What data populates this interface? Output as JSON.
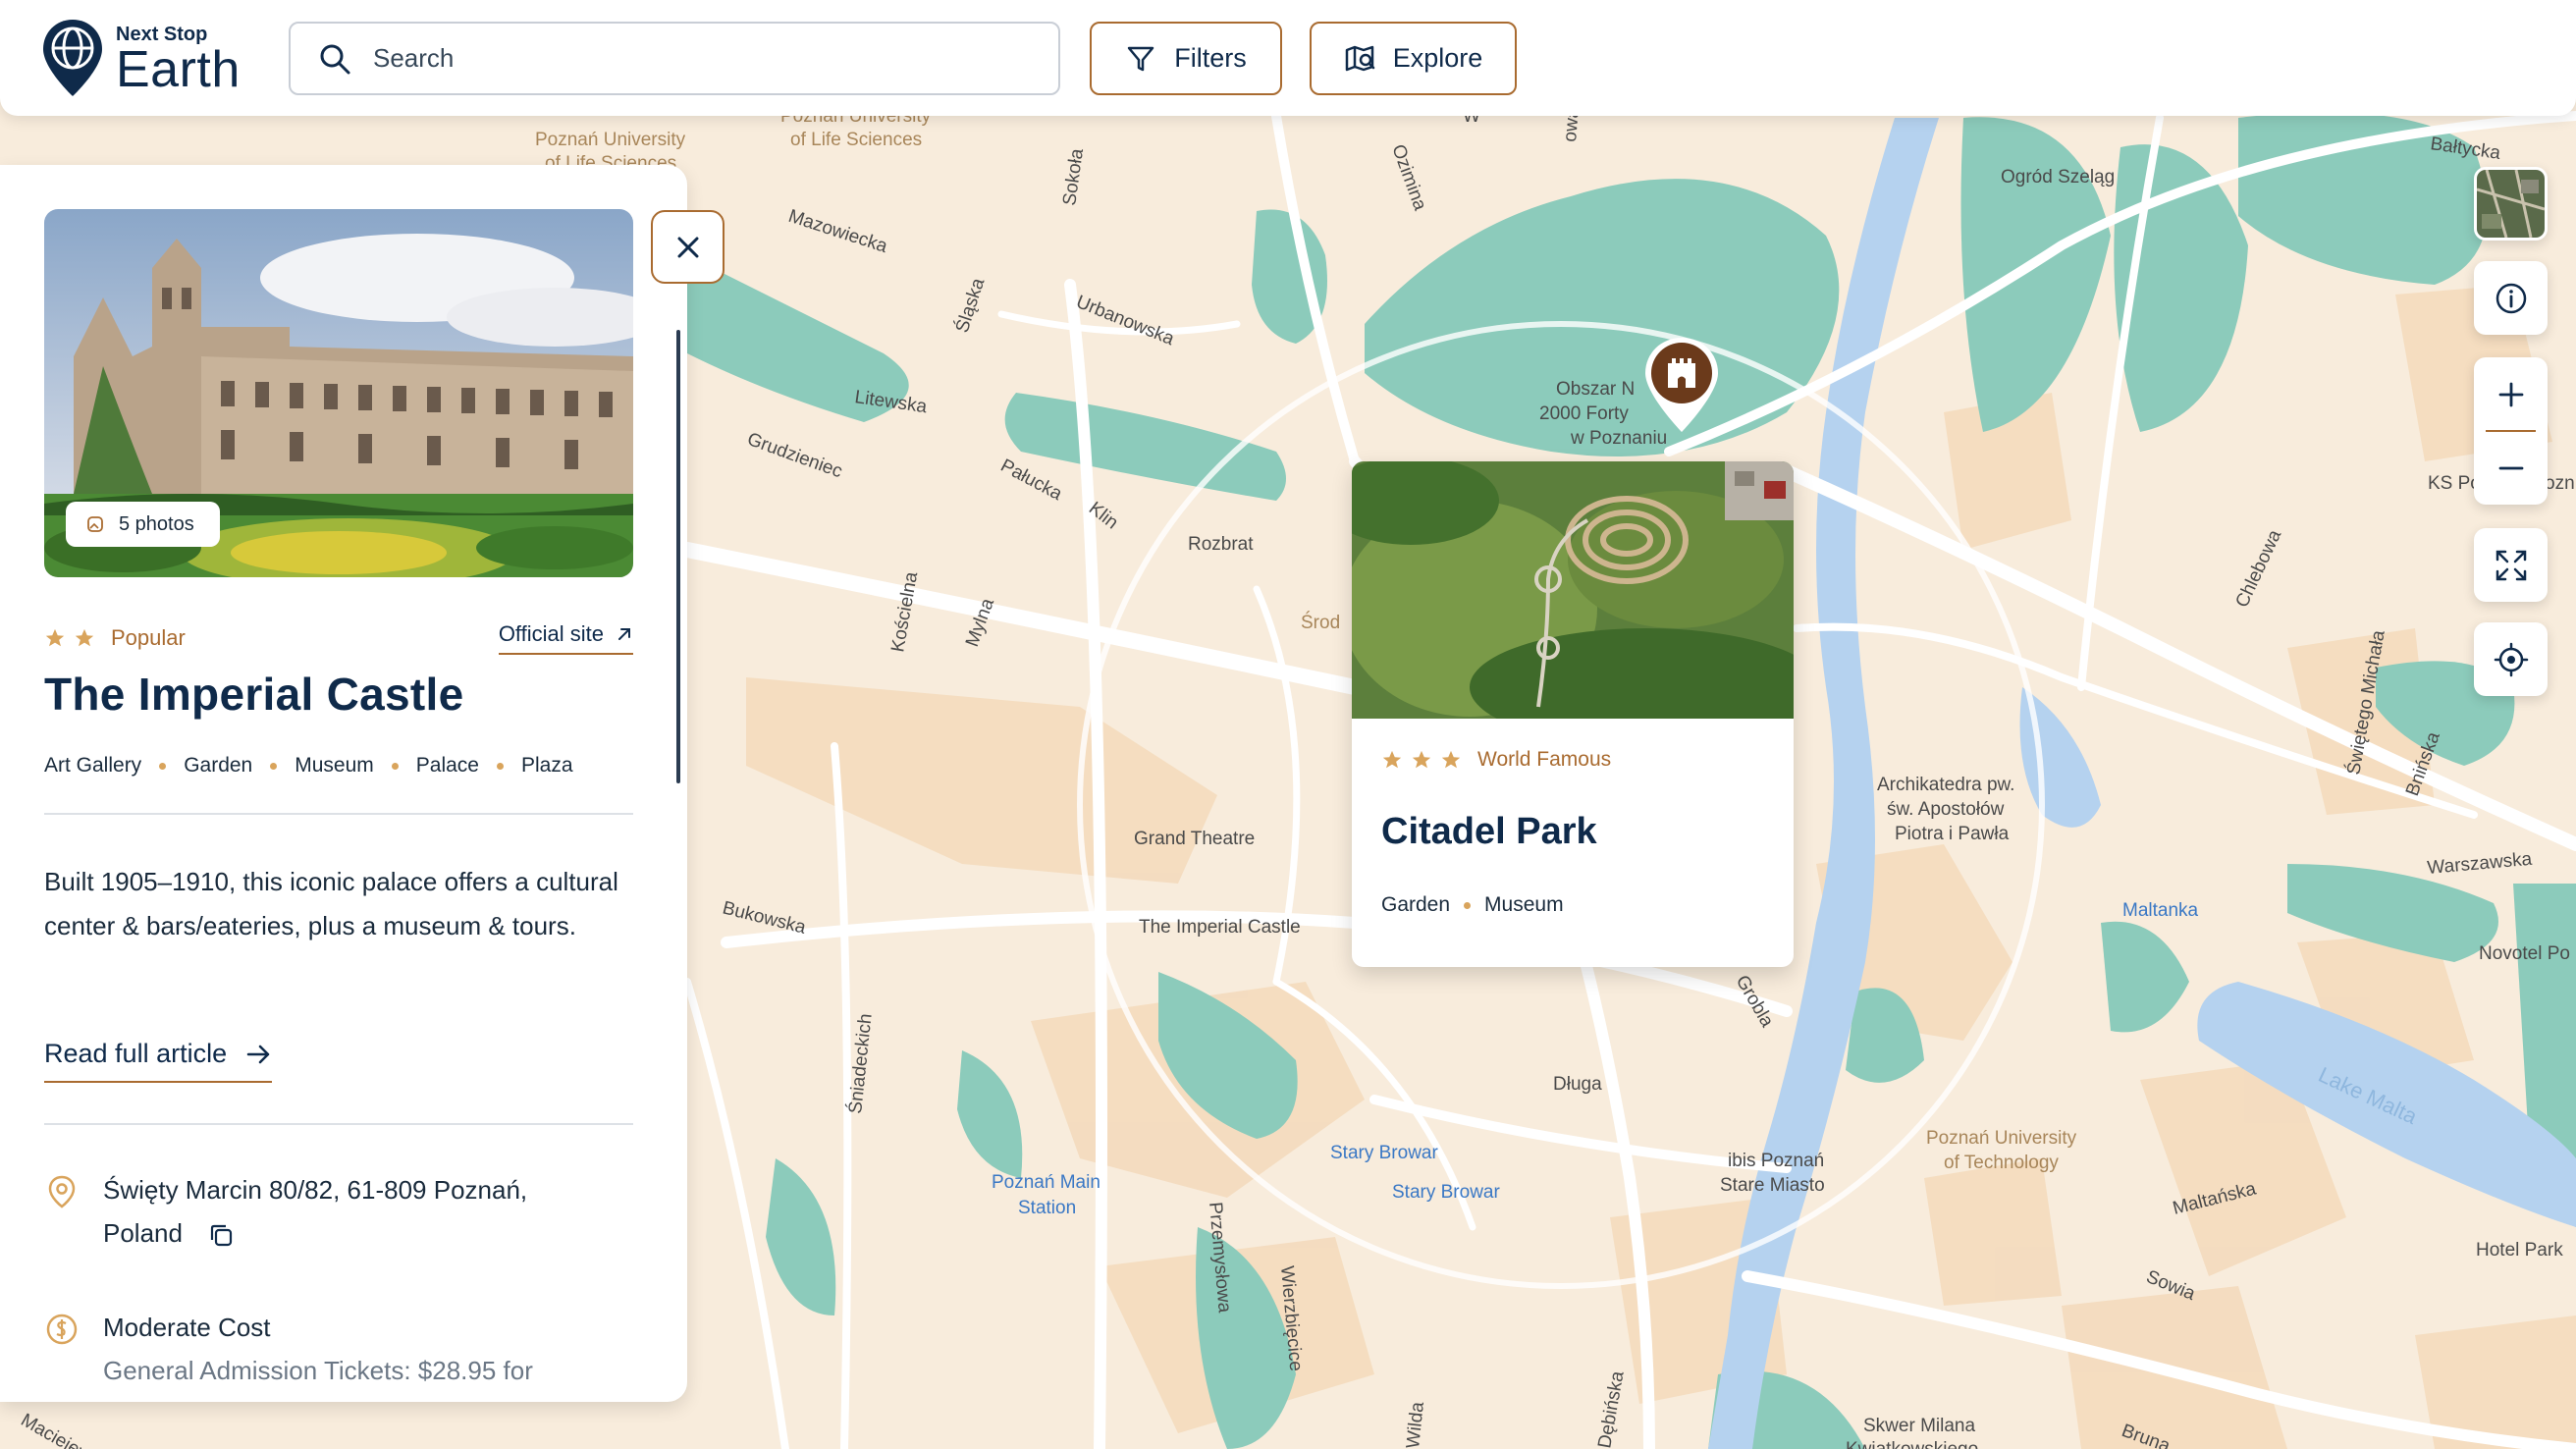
{
  "header": {
    "logo_small": "Next Stop",
    "logo_big": "Earth",
    "search_placeholder": "Search",
    "filters_label": "Filters",
    "explore_label": "Explore"
  },
  "panel": {
    "photos_label": "5 photos",
    "rating_label": "Popular",
    "rating_stars": 2,
    "official_site_label": "Official site",
    "title": "The Imperial Castle",
    "tags": [
      "Art Gallery",
      "Garden",
      "Museum",
      "Palace",
      "Plaza"
    ],
    "description": "Built 1905–1910, this iconic palace offers a cultural center & bars/eateries, plus a museum & tours.",
    "read_more_label": "Read full article",
    "address_line1": "Święty Marcin 80/82, 61-809 Poznań,",
    "address_line2": "Poland",
    "cost_label": "Moderate Cost",
    "cost_detail": "General Admission Tickets: $28.95 for"
  },
  "popup": {
    "rating_label": "World Famous",
    "rating_stars": 3,
    "title": "Citadel Park",
    "tags": [
      "Garden",
      "Museum"
    ]
  },
  "map": {
    "labels": [
      {
        "text": "Poznań University",
        "kind": "brown"
      },
      {
        "text": "of Life Sciences",
        "kind": "brown"
      },
      {
        "text": "Poznań University",
        "kind": "brown"
      },
      {
        "text": "of Life Sciences",
        "kind": "brown"
      },
      {
        "text": "Mazowiecka",
        "kind": "street"
      },
      {
        "text": "Sokoła",
        "kind": "street"
      },
      {
        "text": "Śląska",
        "kind": "street"
      },
      {
        "text": "Urbanowska",
        "kind": "street"
      },
      {
        "text": "Litewska",
        "kind": "street"
      },
      {
        "text": "Grudzieniec",
        "kind": "street"
      },
      {
        "text": "Pałucka",
        "kind": "street"
      },
      {
        "text": "Klin",
        "kind": "street"
      },
      {
        "text": "Rozbrat",
        "kind": "street"
      },
      {
        "text": "Kościelna",
        "kind": "street"
      },
      {
        "text": "Mylna",
        "kind": "street"
      },
      {
        "text": "Grand Theatre",
        "kind": "street"
      },
      {
        "text": "The Imperial Castle",
        "kind": "street"
      },
      {
        "text": "Bukowska",
        "kind": "street"
      },
      {
        "text": "Śniadeckich",
        "kind": "street"
      },
      {
        "text": "Poznań Main",
        "kind": "blue"
      },
      {
        "text": "Station",
        "kind": "blue"
      },
      {
        "text": "Przemysłowa",
        "kind": "street"
      },
      {
        "text": "Wierzbięcice",
        "kind": "street"
      },
      {
        "text": "Stary Browar",
        "kind": "blue"
      },
      {
        "text": "Stary Browar",
        "kind": "blue"
      },
      {
        "text": "Długa",
        "kind": "street"
      },
      {
        "text": "Grobla",
        "kind": "street"
      },
      {
        "text": "ibis Poznań",
        "kind": "street"
      },
      {
        "text": "Stare Miasto",
        "kind": "street"
      },
      {
        "text": "Poznań University",
        "kind": "brown"
      },
      {
        "text": "of Technology",
        "kind": "brown"
      },
      {
        "text": "Archikatedra pw.",
        "kind": "street"
      },
      {
        "text": "św. Apostołów",
        "kind": "street"
      },
      {
        "text": "Piotra i Pawła",
        "kind": "street"
      },
      {
        "text": "Maltanka",
        "kind": "blue"
      },
      {
        "text": "Warszawska",
        "kind": "street"
      },
      {
        "text": "Novotel Po",
        "kind": "street"
      },
      {
        "text": "Lake Malta",
        "kind": "street"
      },
      {
        "text": "Maltańska",
        "kind": "street"
      },
      {
        "text": "Hotel Park",
        "kind": "street"
      },
      {
        "text": "Sowia",
        "kind": "street"
      },
      {
        "text": "Ogród Szeląg",
        "kind": "street"
      },
      {
        "text": "Bałtycka",
        "kind": "street"
      },
      {
        "text": "KS Po",
        "kind": "street"
      },
      {
        "text": "ozn",
        "kind": "street"
      },
      {
        "text": "Chlebowa",
        "kind": "street"
      },
      {
        "text": "Świętego Michała",
        "kind": "street"
      },
      {
        "text": "Bnińska",
        "kind": "street"
      },
      {
        "text": "Obszar N",
        "kind": "street"
      },
      {
        "text": "2000 Forty",
        "kind": "street"
      },
      {
        "text": "w Poznaniu",
        "kind": "street"
      },
      {
        "text": "Środ",
        "kind": "brown"
      },
      {
        "text": "Ozimina",
        "kind": "street"
      },
      {
        "text": "Wilda",
        "kind": "street"
      },
      {
        "text": "Dębińska",
        "kind": "street"
      },
      {
        "text": "Skwer Milana",
        "kind": "street"
      },
      {
        "text": "Kwiatkowskiego",
        "kind": "street"
      },
      {
        "text": "Maciejewicza",
        "kind": "street"
      },
      {
        "text": "Bruna",
        "kind": "street"
      },
      {
        "text": "owa",
        "kind": "street"
      },
      {
        "text": "W",
        "kind": "street"
      }
    ]
  },
  "colors": {
    "brand_navy": "#0f2a4a",
    "accent_brown": "#a96b30",
    "map_green": "#8ccbbb",
    "map_blue": "#b5d2ef",
    "map_land": "#f8ecdc"
  }
}
